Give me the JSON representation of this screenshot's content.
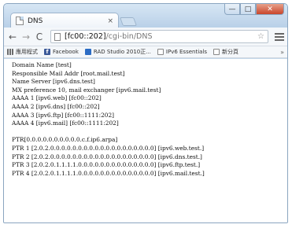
{
  "tab": {
    "title": "DNS",
    "close_glyph": "×"
  },
  "window_controls": {
    "minimize": "—",
    "maximize": "□",
    "close": "✕"
  },
  "toolbar": {
    "back_glyph": "←",
    "forward_glyph": "→",
    "reload_glyph": "C",
    "url_host": "[fc00::202]",
    "url_path": "/cgi-bin/DNS",
    "star_glyph": "☆"
  },
  "bookmarks": [
    {
      "label": "應用程式",
      "icon": "apps-grid-icon"
    },
    {
      "label": "Facebook",
      "icon": "facebook-icon"
    },
    {
      "label": "RAD Studio 2010正...",
      "icon": "rad-studio-icon"
    },
    {
      "label": "IPv6 Essentials",
      "icon": "page-icon"
    },
    {
      "label": "新分頁",
      "icon": "page-icon"
    }
  ],
  "bookmarks_more": "»",
  "content": {
    "lines": [
      "Domain Name [test]",
      "Responsible Mail Addr [root.mail.test]",
      "Name Server [ipv6.dns.test]",
      "MX preference 10, mail exchanger [ipv6.mail.test]",
      "AAAA 1 [ipv6.web] [fc00::202]",
      "AAAA 2 [ipv6.dns] [fc00::202]",
      "AAAA 3 [ipv6.ftp] [fc00::1111:202]",
      "AAAA 4 [ipv6.mail] [fc00::1111:202]",
      "",
      "PTR[0.0.0.0.0.0.0.0.0.0.c.f.ip6.arpa]",
      "PTR 1 [2.0.2.0.0.0.0.0.0.0.0.0.0.0.0.0.0.0.0.0.0.0] [ipv6.web.test.]",
      "PTR 2 [2.0.2.0.0.0.0.0.0.0.0.0.0.0.0.0.0.0.0.0.0.0] [ipv6.dns.test.]",
      "PTR 3 [2.0.2.0.1.1.1.1.0.0.0.0.0.0.0.0.0.0.0.0.0.0] [ipv6.ftp.test.]",
      "PTR 4 [2.0.2.0.1.1.1.1.0.0.0.0.0.0.0.0.0.0.0.0.0.0] [ipv6.mail.test.]"
    ]
  }
}
